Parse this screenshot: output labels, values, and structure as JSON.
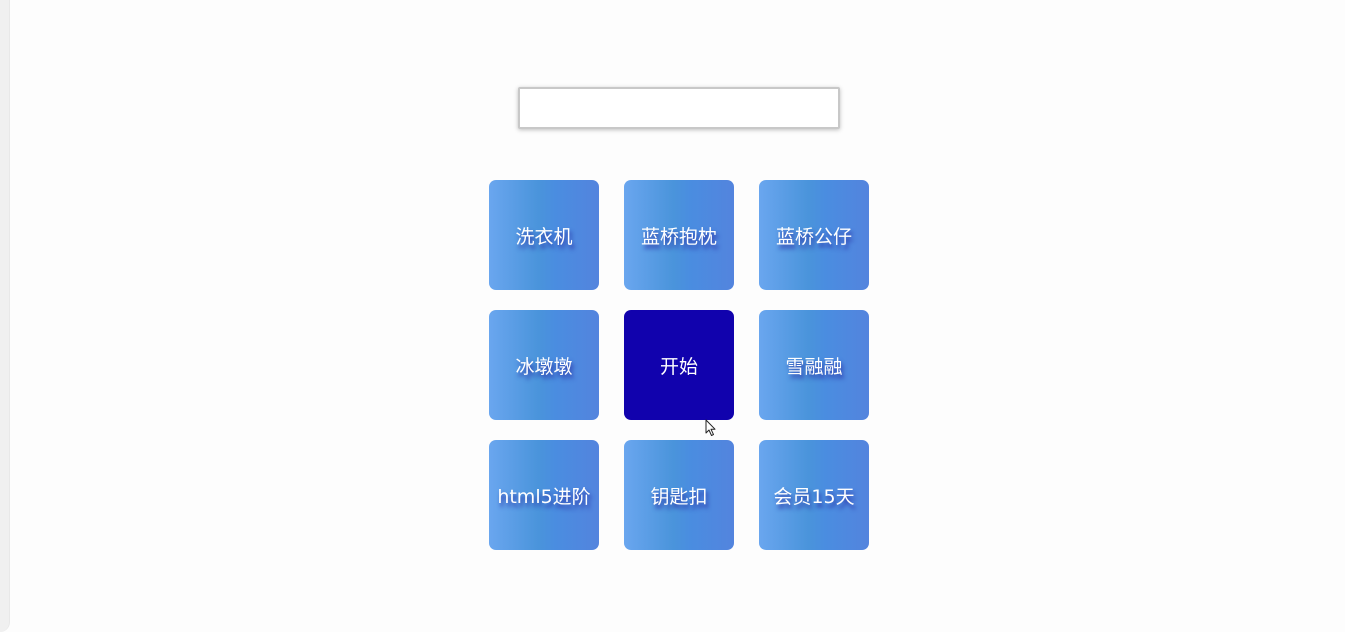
{
  "search": {
    "value": "",
    "placeholder": ""
  },
  "grid": {
    "cells": [
      {
        "label": "洗衣机",
        "kind": "prize"
      },
      {
        "label": "蓝桥抱枕",
        "kind": "prize"
      },
      {
        "label": "蓝桥公仔",
        "kind": "prize"
      },
      {
        "label": "冰墩墩",
        "kind": "prize"
      },
      {
        "label": "开始",
        "kind": "start"
      },
      {
        "label": "雪融融",
        "kind": "prize"
      },
      {
        "label": "html5进阶",
        "kind": "prize"
      },
      {
        "label": "钥匙扣",
        "kind": "prize"
      },
      {
        "label": "会员15天",
        "kind": "prize"
      }
    ]
  },
  "colors": {
    "prize_gradient": [
      "#6aa6ef",
      "#4a94db",
      "#5384de"
    ],
    "start_bg": "#1102ad",
    "text": "#ffffff",
    "text_shadow": "#2b35a8"
  },
  "icons": {
    "cursor": "mouse-pointer-icon"
  }
}
